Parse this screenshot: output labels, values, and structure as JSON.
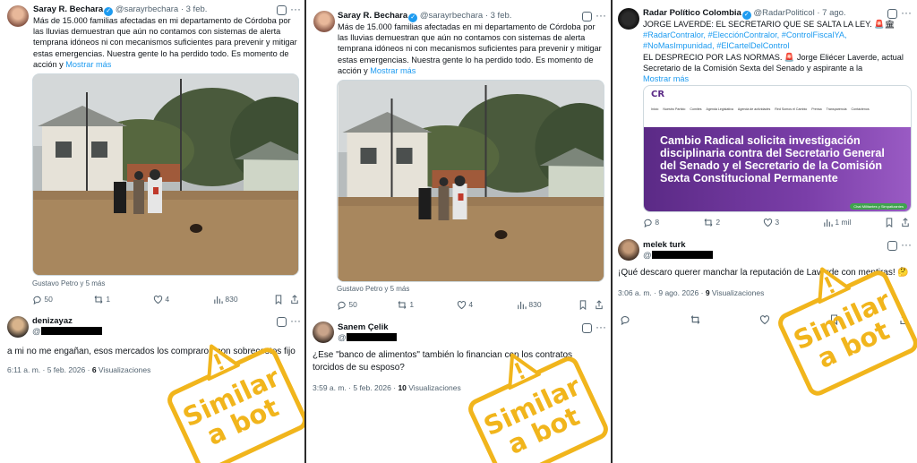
{
  "panels": [
    {
      "main": {
        "name": "Saray R. Bechara",
        "handle": "@sarayrbechara",
        "date": "· 3 feb.",
        "text": "Más de 15.000 familias afectadas en mi departamento de Córdoba por las lluvias demuestran que aún no contamos con sistemas de alerta temprana idóneos ni con mecanismos suficientes para prevenir y mitigar estas emergencias. Nuestra gente lo ha perdido todo. Es momento de acción y",
        "more": "Mostrar más",
        "caption": "Gustavo Petro y 5 más",
        "replies": "50",
        "reposts": "1",
        "likes": "4",
        "views": "830"
      },
      "reply": {
        "name": "denizayaz",
        "handle": "@",
        "text": "a mi no me engañan, esos mercados los compraron con sobrecostos fijo",
        "time": "6:11 a. m. · 5 feb. 2026 · ",
        "views_count": "6",
        "views_label": " Visualizaciones"
      },
      "stamp": {
        "line1": "Similar",
        "line2": "a bot"
      }
    },
    {
      "main": {
        "name": "Saray R. Bechara",
        "handle": "@sarayrbechara",
        "date": "· 3 feb.",
        "text": "Más de 15.000 familias afectadas en mi departamento de Córdoba por las lluvias demuestran que aún no contamos con sistemas de alerta temprana idóneos ni con mecanismos suficientes para prevenir y mitigar estas emergencias. Nuestra gente lo ha perdido todo. Es momento de acción y",
        "more": "Mostrar más",
        "caption": "Gustavo Petro y 5 más",
        "replies": "50",
        "reposts": "1",
        "likes": "4",
        "views": "830"
      },
      "reply": {
        "name": "Sanem Çelik",
        "handle": "@",
        "text": "¿Ese \"banco de alimentos\" también lo financian con los contratos torcidos de su esposo?",
        "time": "3:59 a. m. · 5 feb. 2026 · ",
        "views_count": "10",
        "views_label": " Visualizaciones"
      },
      "stamp": {
        "line1": "Similar",
        "line2": "a bot"
      }
    },
    {
      "main": {
        "name": "Radar Político Colombia",
        "handle": "@RadarPoliticol",
        "date": "· 7 ago.",
        "line1": "JORGE LAVERDE: EL SECRETARIO QUE SE SALTA LA LEY. 🚨🏛",
        "hashtags1": "#RadarContralor, #ElecciónContralor, #ControlFiscalYA,",
        "hashtags2": "#NoMasImpunidad, #ElCartelDelControl",
        "line2": "EL DESPRECIO POR LAS NORMAS. 🚨 Jorge Eliécer Laverde, actual Secretario de la Comisión Sexta del Senado y aspirante a la",
        "more": "Mostrar más",
        "card_logo": "CR",
        "card_nav": [
          "Inicio",
          "Nuestro Partido",
          "Comités",
          "Agenda Legislativa",
          "Agenda de actividades",
          "Red Somos el Cambio",
          "Prensa",
          "Transparencia",
          "Contáctenos"
        ],
        "card_headline": "Cambio Radical solicita investigación disciplinaria contra del Secretario General del Senado y el Secretario de la Comisión Sexta Constitucional Permanente",
        "card_chat": "Chat Militantes y Simpatizantes",
        "replies": "8",
        "reposts": "2",
        "likes": "3",
        "views": "1 mil"
      },
      "reply": {
        "name": "melek turk",
        "handle": "@",
        "text": "¡Qué descaro querer manchar la reputación de Laverde con mentiras! 🤔",
        "time": "3:06 a. m. · 9 ago. 2026 · ",
        "views_count": "9",
        "views_label": " Visualizaciones"
      },
      "stamp": {
        "line1": "Similar",
        "line2": "a bot"
      }
    }
  ],
  "colors": {
    "stamp": "#f1b51c",
    "link": "#1d9bf0",
    "muted": "#536471",
    "card_banner": "#5b2a86"
  },
  "icons": [
    "avatar",
    "verified-badge-icon",
    "grok-icon",
    "more-icon",
    "reply-icon",
    "repost-icon",
    "like-icon",
    "views-icon",
    "bookmark-icon",
    "share-icon",
    "warning-icon"
  ]
}
